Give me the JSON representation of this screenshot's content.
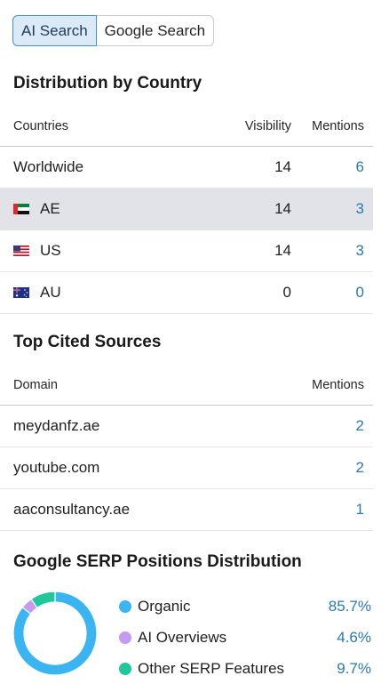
{
  "tabs": {
    "ai_search": "AI Search",
    "google_search": "Google Search"
  },
  "distribution": {
    "title": "Distribution by Country",
    "columns": {
      "country": "Countries",
      "visibility": "Visibility",
      "mentions": "Mentions"
    },
    "rows": [
      {
        "country": "Worldwide",
        "flag": "none",
        "visibility": "14",
        "mentions": "6"
      },
      {
        "country": "AE",
        "flag": "ae-flag-icon",
        "visibility": "14",
        "mentions": "3"
      },
      {
        "country": "US",
        "flag": "us-flag-icon",
        "visibility": "14",
        "mentions": "3"
      },
      {
        "country": "AU",
        "flag": "au-flag-icon",
        "visibility": "0",
        "mentions": "0"
      }
    ]
  },
  "sources": {
    "title": "Top Cited Sources",
    "columns": {
      "domain": "Domain",
      "mentions": "Mentions"
    },
    "rows": [
      {
        "domain": "meydanfz.ae",
        "mentions": "2"
      },
      {
        "domain": "youtube.com",
        "mentions": "2"
      },
      {
        "domain": "aaconsultancy.ae",
        "mentions": "1"
      }
    ]
  },
  "serp": {
    "title": "Google SERP Positions Distribution",
    "legend": [
      {
        "label": "Organic",
        "value": "85.7%",
        "color": "#3bb4f2"
      },
      {
        "label": "AI Overviews",
        "value": "4.6%",
        "color": "#c59af0"
      },
      {
        "label": "Other SERP Features",
        "value": "9.7%",
        "color": "#1fc79a"
      }
    ]
  },
  "chart_data": {
    "type": "pie",
    "categories": [
      "Organic",
      "AI Overviews",
      "Other SERP Features"
    ],
    "values": [
      85.7,
      4.6,
      9.7
    ],
    "title": "Google SERP Positions Distribution"
  }
}
